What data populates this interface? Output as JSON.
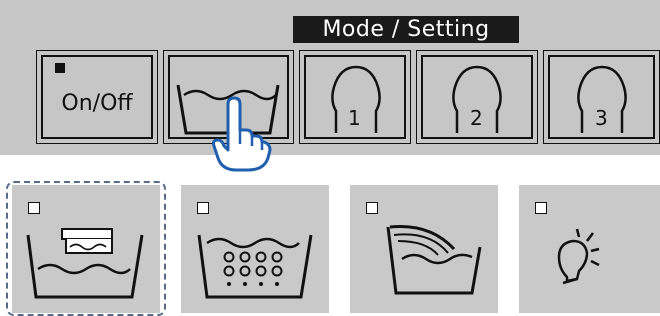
{
  "header": {
    "mode_label": "Mode / Setting"
  },
  "top_buttons": [
    {
      "id": "on-off",
      "label": "On/Off"
    },
    {
      "id": "tub-mode"
    },
    {
      "id": "memory-1",
      "number": "1"
    },
    {
      "id": "memory-2",
      "number": "2"
    },
    {
      "id": "memory-3",
      "number": "3"
    }
  ],
  "lower_buttons": [
    {
      "id": "heat-water",
      "icon": "tub-heater-icon",
      "focused": true
    },
    {
      "id": "bubble-bath",
      "icon": "tub-bubbles-icon"
    },
    {
      "id": "water-fill",
      "icon": "tub-fill-icon"
    },
    {
      "id": "light",
      "icon": "light-bulb-icon"
    }
  ],
  "colors": {
    "panel": "#c6c6c6",
    "label_bg": "#1a1a1a",
    "focus_ring": "#556b88"
  }
}
